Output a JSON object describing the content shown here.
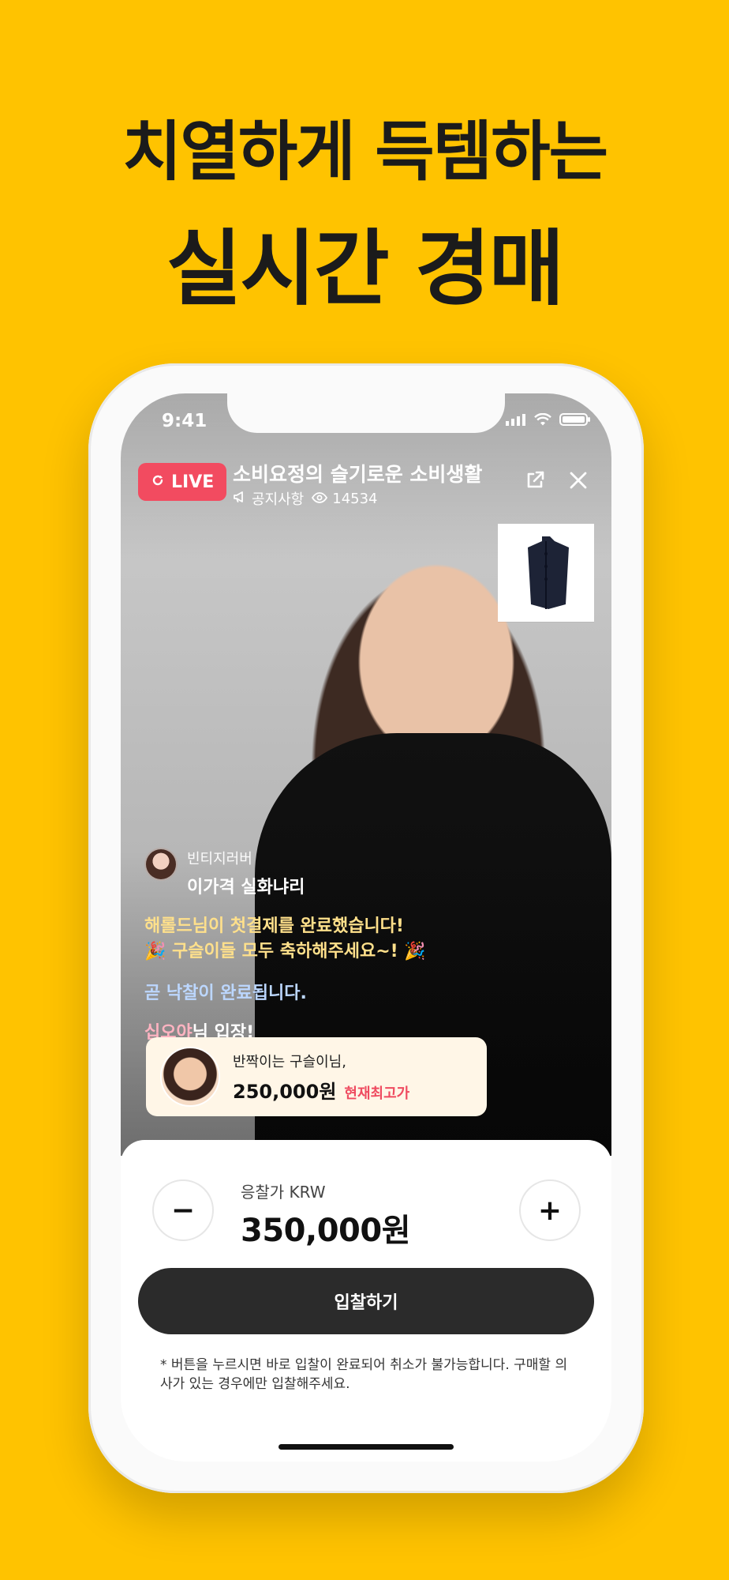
{
  "promo": {
    "headline_line1": "치열하게 득템하는",
    "headline_line2": "실시간 경매"
  },
  "status_bar": {
    "time": "9:41",
    "icons": [
      "signal-icon",
      "wifi-icon",
      "battery-icon"
    ]
  },
  "live": {
    "badge_label": "LIVE",
    "title": "소비요정의 슬기로운 소비생활",
    "notice_label": "공지사항",
    "viewer_count": "14534",
    "colors": {
      "badge": "#f24b60"
    }
  },
  "chat": {
    "commenter_name": "빈티지러버",
    "commenter_message": "이가격 실화냐리",
    "system_congrats_line1": "해롤드님이 첫결제를 완료했습니다!",
    "system_congrats_line2": "🎉 구슬이들 모두 축하해주세요~! 🎉",
    "system_status": "곧 낙찰이 완료됩니다.",
    "entry_user": "십오야",
    "entry_suffix": "님 입장!"
  },
  "top_bid": {
    "bidder_line": "반짝이는 구슬이님,",
    "amount": "250,000원",
    "tag": "현재최고가"
  },
  "bid_panel": {
    "label": "응찰가 KRW",
    "value": "350,000원",
    "minus": "−",
    "plus": "+",
    "cta": "입찰하기",
    "notice": "* 버튼을 누르시면 바로 입찰이 완료되어 취소가 불가능합니다. 구매할 의사가 있는 경우에만 입찰해주세요.",
    "colors": {
      "cta_bg": "#2b2b2b",
      "accent_red": "#ef4b60"
    }
  },
  "colors": {
    "page_bg": "#FFC300"
  }
}
